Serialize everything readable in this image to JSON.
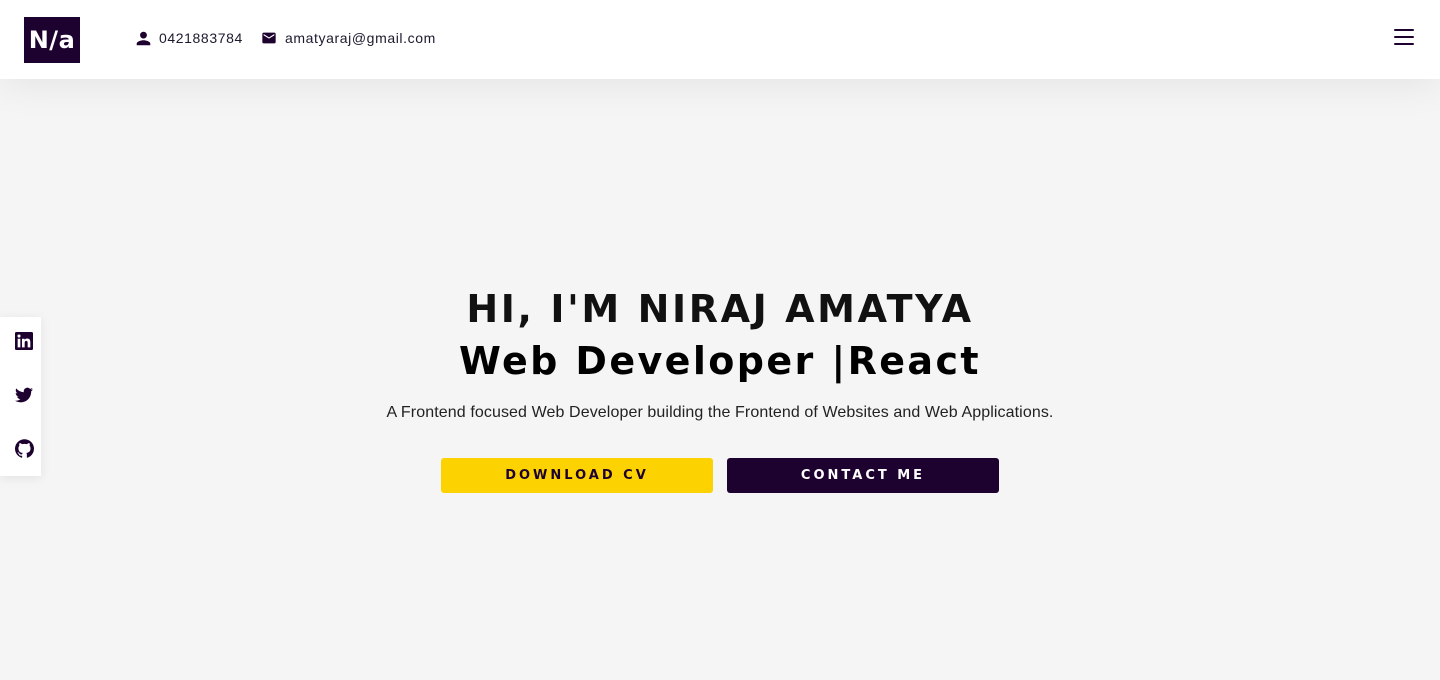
{
  "header": {
    "logo_text": "N/a",
    "phone": "0421883784",
    "email": "amatyaraj@gmail.com",
    "phone_icon": "person-icon",
    "email_icon": "mail-icon",
    "menu_icon": "hamburger-menu-icon"
  },
  "social": {
    "items": [
      {
        "name": "linkedin",
        "icon": "linkedin-icon"
      },
      {
        "name": "twitter",
        "icon": "twitter-icon"
      },
      {
        "name": "github",
        "icon": "github-icon"
      }
    ]
  },
  "hero": {
    "title": "HI, I'M NIRAJ AMATYA",
    "subtitle": "Web Developer |React",
    "description": "A Frontend focused Web Developer building the Frontend of Websites and Web Applications.",
    "download_cv_label": "DOWNLOAD CV",
    "contact_label": "CONTACT ME"
  },
  "colors": {
    "brand_dark": "#1d0230",
    "accent_yellow": "#fcd200",
    "page_background": "#f5f5f5",
    "header_background": "#ffffff"
  }
}
